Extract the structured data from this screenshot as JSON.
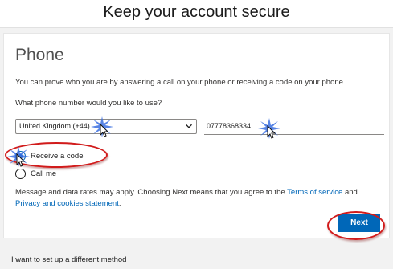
{
  "header": {
    "title": "Keep your account secure"
  },
  "section": {
    "title": "Phone",
    "intro": "You can prove who you are by answering a call on your phone or receiving a code on your phone.",
    "question": "What phone number would you like to use?"
  },
  "form": {
    "country_value": "United Kingdom (+44)",
    "phone_value": "07778368334"
  },
  "options": {
    "receive_code": "Receive a code",
    "call_me": "Call me",
    "selected": "receive_code"
  },
  "disclaimer": {
    "prefix": "Message and data rates may apply. Choosing Next means that you agree to the ",
    "terms_link": "Terms of service",
    "and": " and ",
    "privacy_link": "Privacy and cookies statement",
    "suffix": "."
  },
  "actions": {
    "next_label": "Next",
    "different_method_label": "I want to set up a different method"
  },
  "colors": {
    "accent": "#0067b8",
    "annotation_ring": "#d11b1b"
  }
}
